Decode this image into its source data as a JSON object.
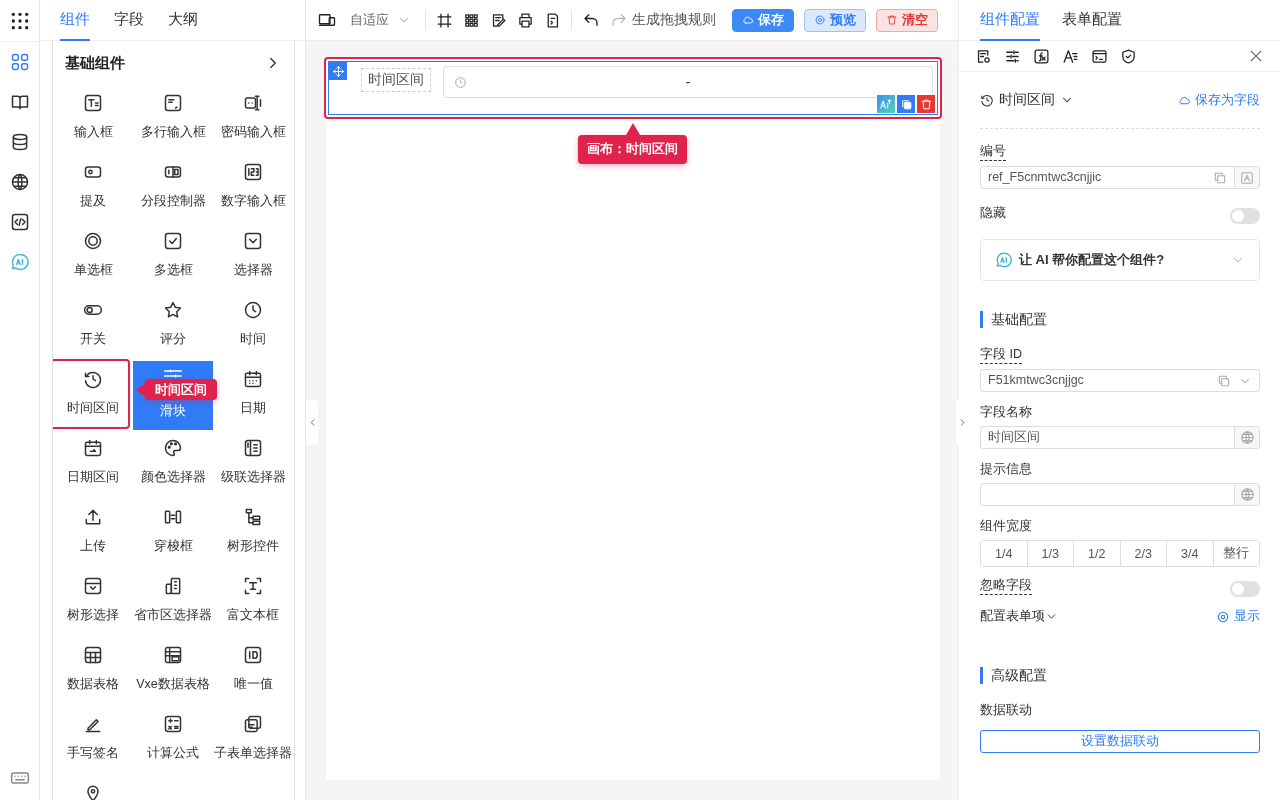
{
  "rail": {
    "items": [
      {
        "selected": true
      },
      {
        "selected": false
      },
      {
        "selected": false
      },
      {
        "selected": false
      },
      {
        "selected": false
      },
      {
        "selected": false
      }
    ]
  },
  "left_panel": {
    "tabs": [
      {
        "label": "组件",
        "selected": true
      },
      {
        "label": "字段",
        "selected": false
      },
      {
        "label": "大纲",
        "selected": false
      }
    ],
    "group_title": "基础组件",
    "items": [
      {
        "label": "输入框",
        "selected": false
      },
      {
        "label": "多行输入框",
        "selected": false
      },
      {
        "label": "密码输入框",
        "selected": false
      },
      {
        "label": "提及",
        "selected": false
      },
      {
        "label": "分段控制器",
        "selected": false
      },
      {
        "label": "数字输入框",
        "selected": false
      },
      {
        "label": "单选框",
        "selected": false
      },
      {
        "label": "多选框",
        "selected": false
      },
      {
        "label": "选择器",
        "selected": false
      },
      {
        "label": "开关",
        "selected": false
      },
      {
        "label": "评分",
        "selected": false
      },
      {
        "label": "时间",
        "selected": false
      },
      {
        "label": "时间区间",
        "selected": false,
        "annotation": "时间区间"
      },
      {
        "label": "滑块",
        "selected": true
      },
      {
        "label": "日期",
        "selected": false
      },
      {
        "label": "日期区间",
        "selected": false
      },
      {
        "label": "颜色选择器",
        "selected": false
      },
      {
        "label": "级联选择器",
        "selected": false
      },
      {
        "label": "上传",
        "selected": false
      },
      {
        "label": "穿梭框",
        "selected": false
      },
      {
        "label": "树形控件",
        "selected": false
      },
      {
        "label": "树形选择",
        "selected": false
      },
      {
        "label": "省市区选择器",
        "selected": false
      },
      {
        "label": "富文本框",
        "selected": false
      },
      {
        "label": "数据表格",
        "selected": false
      },
      {
        "label": "Vxe数据表格",
        "selected": false
      },
      {
        "label": "唯一值",
        "selected": false
      },
      {
        "label": "手写签名",
        "selected": false
      },
      {
        "label": "计算公式",
        "selected": false
      },
      {
        "label": "子表单选择器",
        "selected": false
      },
      {
        "selected": false
      }
    ]
  },
  "toolbar": {
    "layout_select": "自适应",
    "redo_disabled": true,
    "generate_rule": "生成拖拽规则",
    "buttons": [
      {
        "label": "保存",
        "kind": "primary"
      },
      {
        "label": "预览",
        "kind": "info"
      },
      {
        "label": "清空",
        "kind": "danger"
      }
    ]
  },
  "canvas": {
    "field": {
      "label": "时间区间",
      "separator": "-",
      "selected": true,
      "annotation": "画布：时间区间"
    }
  },
  "right_panel": {
    "tabs": [
      {
        "label": "组件配置",
        "selected": true
      },
      {
        "label": "表单配置",
        "selected": false
      }
    ],
    "component_type": "时间区间",
    "save_as_field": "保存为字段",
    "ref": {
      "label": "编号",
      "has_tip": true,
      "value": "ref_F5cnmtwc3cnjjic"
    },
    "hidden": {
      "label": "隐藏",
      "on": false
    },
    "ai_prompt": "让 AI 帮你配置这个组件?",
    "basic": {
      "title": "基础配置",
      "field_id": {
        "label": "字段 ID",
        "has_tip": true,
        "value": "F51kmtwc3cnjjgc"
      },
      "field_name": {
        "label": "字段名称",
        "has_tip": false,
        "value": "时间区间"
      },
      "hint_info": {
        "label": "提示信息",
        "has_tip": false
      },
      "width": {
        "label": "组件宽度",
        "options": [
          {
            "label": "1/4",
            "selected": false
          },
          {
            "label": "1/3",
            "selected": false
          },
          {
            "label": "1/2",
            "selected": false
          },
          {
            "label": "2/3",
            "selected": false
          },
          {
            "label": "3/4",
            "selected": false
          },
          {
            "label": "整行",
            "selected": false
          }
        ]
      },
      "ignore": {
        "label": "忽略字段",
        "has_tip": true,
        "on": false
      },
      "form_items": {
        "label": "配置表单项",
        "action": "显示"
      }
    },
    "advanced": {
      "title": "高级配置",
      "linkage_label": "数据联动",
      "linkage_button": "设置数据联动"
    }
  }
}
